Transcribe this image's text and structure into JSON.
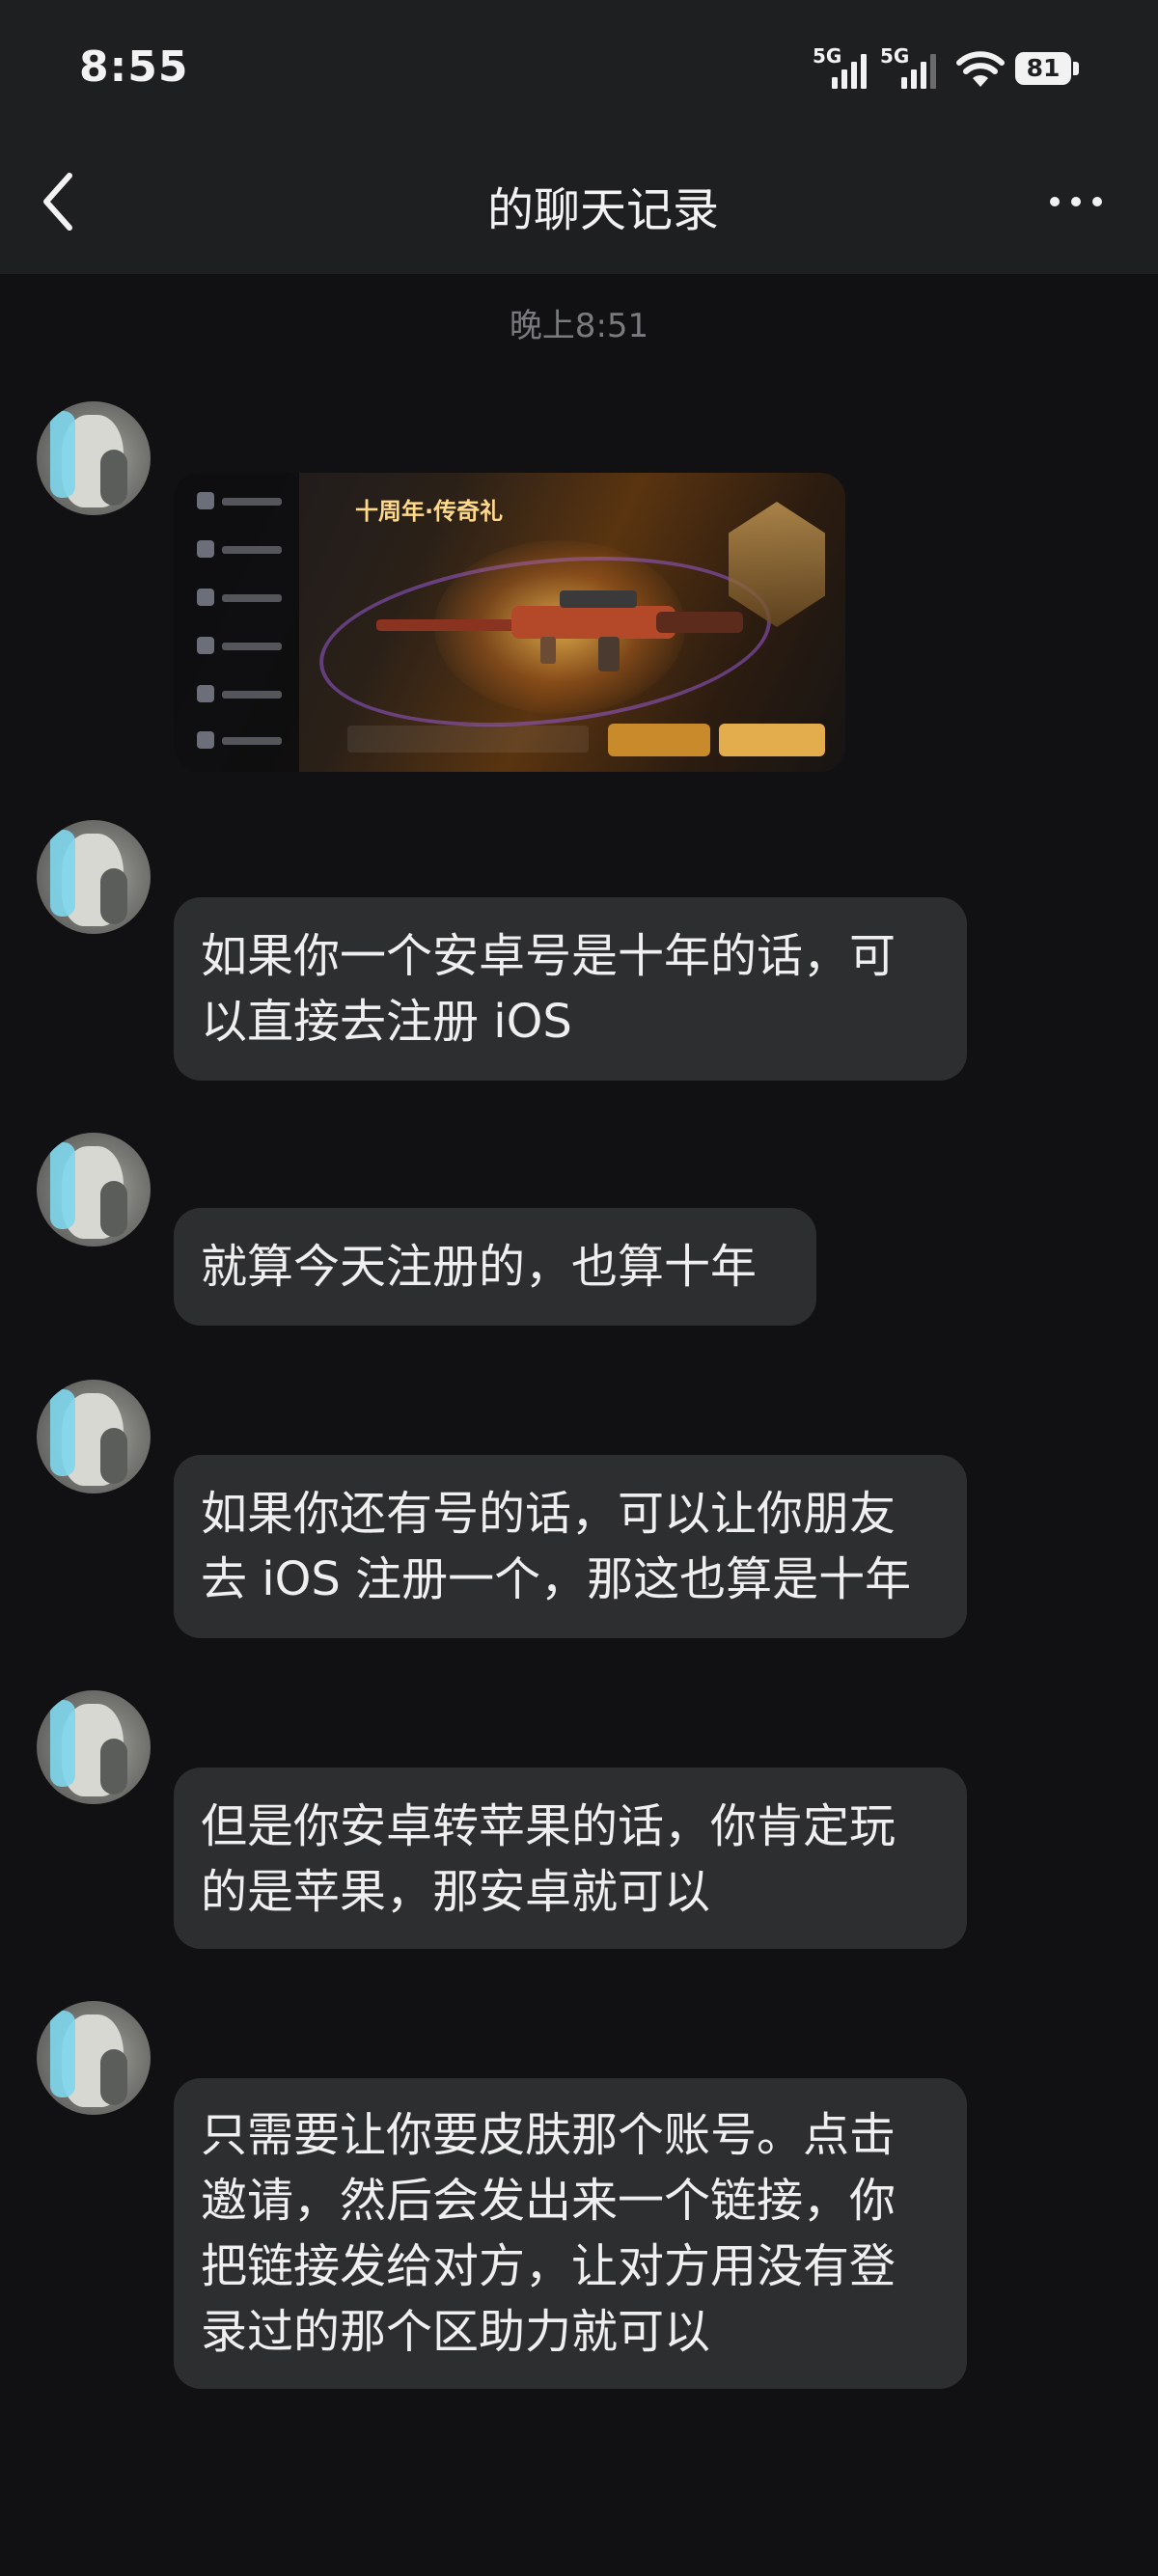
{
  "status_bar": {
    "time": "8:55",
    "signal1_label": "5G",
    "signal2_label": "5G",
    "battery": "81"
  },
  "header": {
    "title": "的聊天记录",
    "back_icon": "chevron-left-icon",
    "more_icon": "more-dots-icon"
  },
  "chat": {
    "timestamp": "晚上8:51",
    "messages": [
      {
        "type": "image"
      },
      {
        "type": "text",
        "text_lines": [
          "如果你一个安卓号是十年的话，可",
          "以直接去注册 iOS"
        ]
      },
      {
        "type": "text",
        "text_lines": [
          "就算今天注册的，也算十年"
        ]
      },
      {
        "type": "text",
        "text_lines": [
          "如果你还有号的话，可以让你朋友",
          "去 iOS 注册一个，那这也算是十年"
        ]
      },
      {
        "type": "text",
        "text_lines": [
          "但是你安卓转苹果的话，你肯定玩",
          "的是苹果，那安卓就可以"
        ]
      },
      {
        "type": "text",
        "text_lines": [
          "只需要让你要皮肤那个账号。点击",
          "邀请，然后会发出来一个链接，你",
          "把链接发给对方，让对方用没有登",
          "录过的那个区助力就可以"
        ]
      }
    ]
  }
}
